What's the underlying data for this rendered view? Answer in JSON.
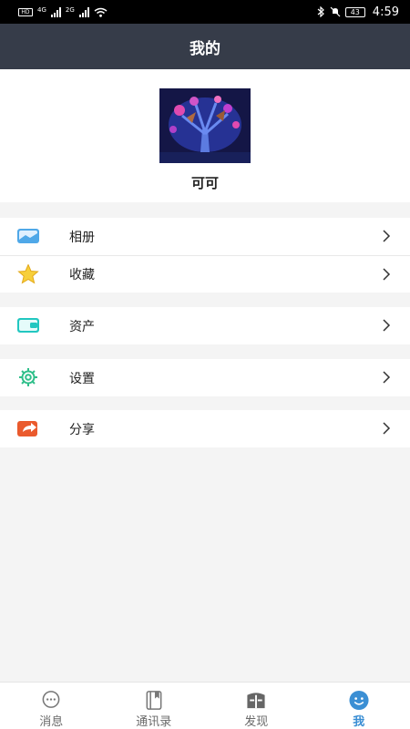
{
  "status": {
    "left_badge": "HD",
    "net1": "4G",
    "net2": "2G",
    "battery": "43",
    "time": "4:59"
  },
  "header": {
    "title": "我的"
  },
  "profile": {
    "nickname": "可可"
  },
  "menu": {
    "album": "相册",
    "favorites": "收藏",
    "assets": "资产",
    "settings": "设置",
    "share": "分享"
  },
  "tabs": [
    {
      "label": "消息",
      "icon": "message-icon"
    },
    {
      "label": "通讯录",
      "icon": "contacts-icon"
    },
    {
      "label": "发现",
      "icon": "discover-icon"
    },
    {
      "label": "我",
      "icon": "me-icon"
    }
  ],
  "colors": {
    "header_bg": "#363c49",
    "tab_active": "#3b8fd4",
    "tab_inactive": "#6a6a6a"
  }
}
